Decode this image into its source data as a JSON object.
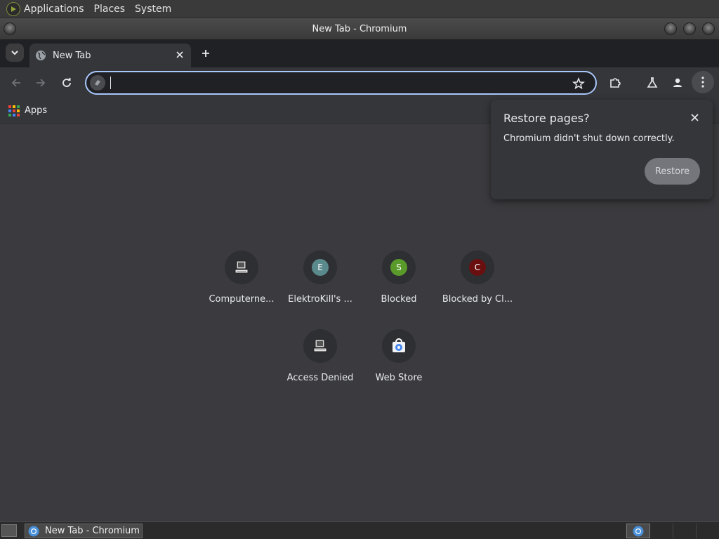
{
  "top_panel": {
    "menus": [
      "Applications",
      "Places",
      "System"
    ]
  },
  "window": {
    "title": "New Tab - Chromium"
  },
  "tabstrip": {
    "active_tab": {
      "title": "New Tab"
    }
  },
  "toolbar": {
    "omnibox_value": ""
  },
  "bookmarks_bar": {
    "apps_label": "Apps",
    "apps_colors": [
      "#ea4335",
      "#fbbc04",
      "#34a853",
      "#4285f4",
      "#ea4335",
      "#fbbc04",
      "#34a853",
      "#4285f4",
      "#ea4335"
    ]
  },
  "shortcuts": [
    {
      "title": "Computerne...",
      "icon": "computer-icon"
    },
    {
      "title": "ElektroKill's ...",
      "letter": "E",
      "color": "#5a8a8c"
    },
    {
      "title": "Blocked",
      "letter": "S",
      "color": "#5a9a2a"
    },
    {
      "title": "Blocked by Cl...",
      "letter": "C",
      "color": "#6a0f0f"
    },
    {
      "title": "Access Denied",
      "icon": "computer-icon"
    },
    {
      "title": "Web Store",
      "icon": "web-store-icon"
    }
  ],
  "restore_popup": {
    "title": "Restore pages?",
    "message": "Chromium didn't shut down correctly.",
    "button": "Restore"
  },
  "taskbar": {
    "item_label": "New Tab - Chromium"
  }
}
